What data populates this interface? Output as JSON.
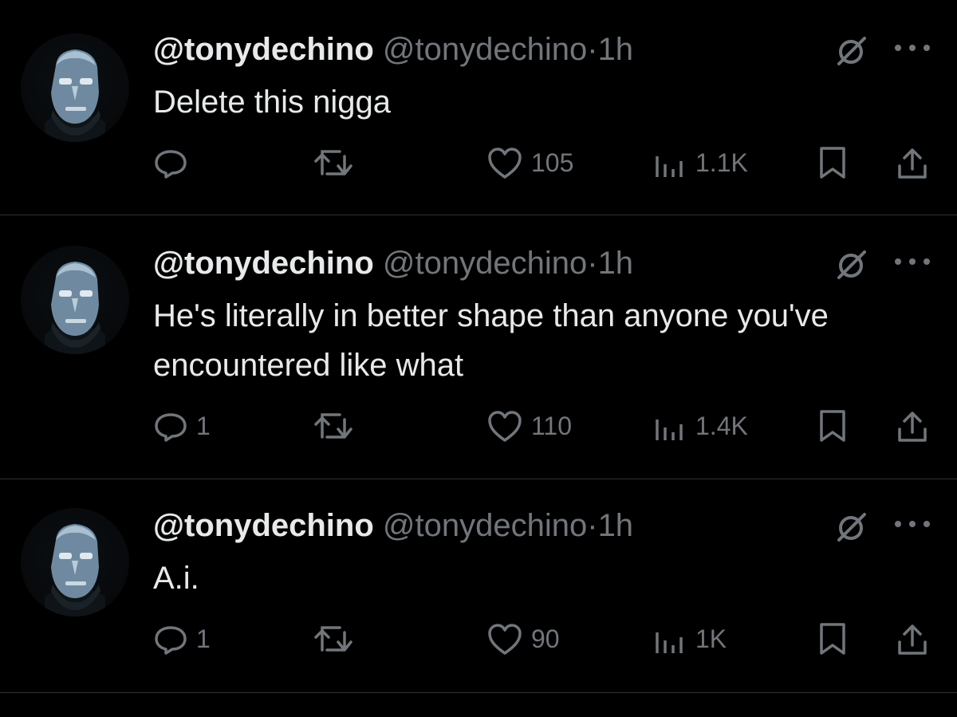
{
  "colors": {
    "background": "#000000",
    "text_primary": "#e7e9ea",
    "text_secondary": "#71767b",
    "divider": "#2f3336"
  },
  "tweets": [
    {
      "display_name": "@tonydechino",
      "handle": "@tonydechino",
      "separator": "·",
      "time": "1h",
      "text": "Delete this nigga",
      "replies": "",
      "retweets": "",
      "likes": "105",
      "views": "1.1K"
    },
    {
      "display_name": "@tonydechino",
      "handle": "@tonydechino",
      "separator": "·",
      "time": "1h",
      "text": "He's literally in better shape than anyone you've encountered like what",
      "replies": "1",
      "retweets": "",
      "likes": "110",
      "views": "1.4K"
    },
    {
      "display_name": "@tonydechino",
      "handle": "@tonydechino",
      "separator": "·",
      "time": "1h",
      "text": "A.i.",
      "replies": "1",
      "retweets": "",
      "likes": "90",
      "views": "1K"
    }
  ],
  "icons": {
    "grok": "grok-icon",
    "more": "more-icon",
    "reply": "reply-icon",
    "retweet": "retweet-icon",
    "like": "heart-icon",
    "views": "views-icon",
    "bookmark": "bookmark-icon",
    "share": "share-icon"
  }
}
